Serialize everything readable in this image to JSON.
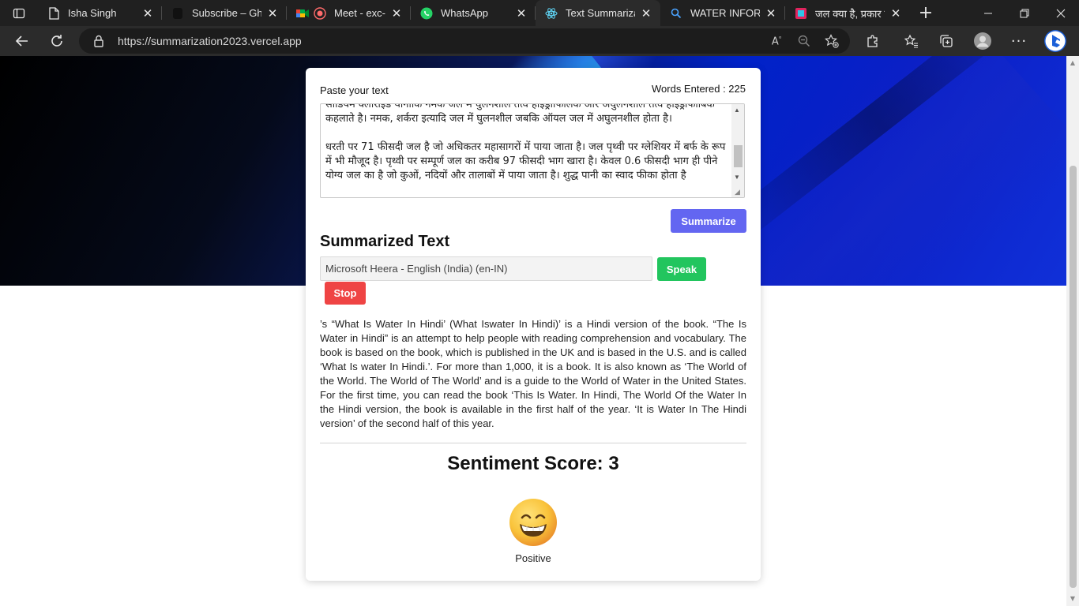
{
  "browser": {
    "tabs": [
      {
        "title": "Isha Singh",
        "icon": "document-icon",
        "active": false
      },
      {
        "title": "Subscribe – Ghost",
        "icon": "ghost-icon",
        "active": false
      },
      {
        "title": "Meet - exc-b",
        "icon": "meet-icon",
        "active": false
      },
      {
        "title": "WhatsApp",
        "icon": "whatsapp-icon",
        "active": false
      },
      {
        "title": "Text Summarizatio",
        "icon": "react-icon",
        "active": true
      },
      {
        "title": "WATER INFORMA",
        "icon": "search-icon",
        "active": false
      },
      {
        "title": "जल क्या है, प्रकार व",
        "icon": "site-icon",
        "active": false
      }
    ],
    "url": "https://summarization2023.vercel.app"
  },
  "app": {
    "paste_label": "Paste your text",
    "words_entered": "Words Entered : 225",
    "input_text": "सोडियम क्लोराइड यानीकि नमक जल में घुलनशील तत्व हाइड्रोफिलिक और अघुलनशील तत्व हाइड्रोफोबिक कहलाते है। नमक, शर्करा इत्यादि जल में घुलनशील जबकि ऑयल जल में अघुलनशील होता है।\n\nधरती पर 71 फीसदी जल है जो अधिकतर महासागरों में पाया जाता है। जल पृथ्वी पर ग्लेशियर में बर्फ के रूप में भी मौजूद है। पृथ्वी पर सम्पूर्ण जल का करीब 97 फीसदी भाग खारा है। केवल 0.6 फीसदी भाग ही पीने योग्य जल का है जो कुओं, नदियों और तालाबों में पाया जाता है। शुद्ध पानी का स्वाद फीका होता है",
    "summarize_button": "Summarize",
    "summarized_heading": "Summarized Text",
    "voice_selected": "Microsoft Heera - English (India) (en-IN)",
    "speak_button": "Speak",
    "stop_button": "Stop",
    "summary_text": "’s “What Is Water In Hindi’ (What Iswater In Hindi)’ is a Hindi version of the book. “The Is Water in Hindi” is an attempt to help people with reading comprehension and vocabulary. The book is based on the book, which is published in the UK and is based in the U.S. and is called ‘What Is water In Hindi.’. For more than 1,000, it is a book. It is also known as ‘The World of the World. The World of The World’ and is a guide to the World of Water in the United States. For the first time, you can read the book ‘This Is Water. In Hindi, The World Of the Water In the Hindi version, the book is available in the first half of the year. ‘It is Water In The Hindi version’ of the second half of this year.",
    "sentiment_score": "Sentiment Score: 3",
    "sentiment_label": "Positive",
    "sentiment_icon": "grinning-face-icon"
  },
  "colors": {
    "summarize": "#6366f1",
    "speak": "#22c55e",
    "stop": "#ef4444"
  }
}
